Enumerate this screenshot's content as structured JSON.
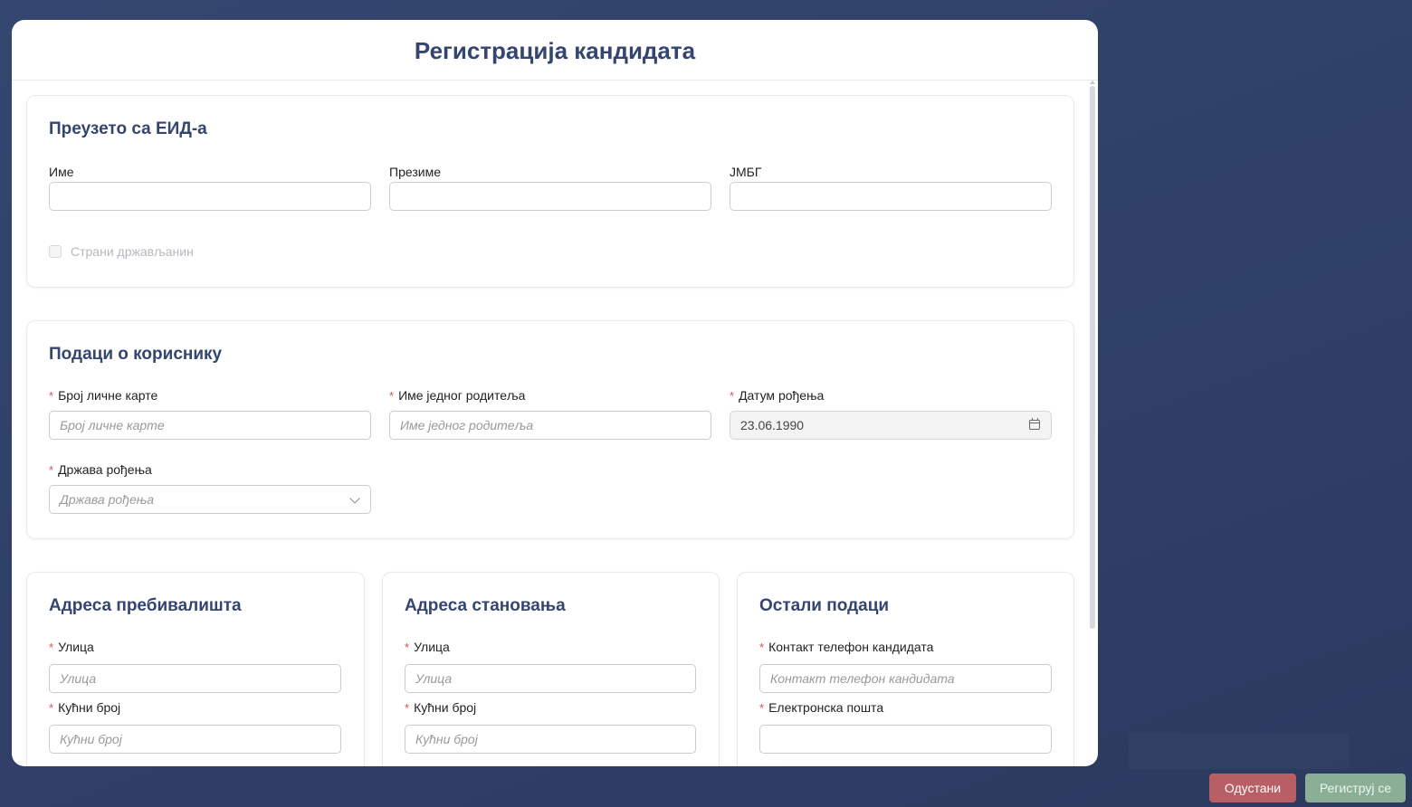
{
  "modal": {
    "title": "Регистрација кандидата"
  },
  "eid_section": {
    "title": "Преузето са ЕИД-а",
    "fields": [
      {
        "label": "Име",
        "value": ""
      },
      {
        "label": "Презиме",
        "value": ""
      },
      {
        "label": "ЈМБГ",
        "value": ""
      }
    ],
    "foreign_citizen": {
      "label": "Страни држављанин",
      "checked": false
    }
  },
  "user_section": {
    "title": "Подаци о кориснику",
    "id_card": {
      "label": "Број личне карте",
      "placeholder": "Број личне карте",
      "required": true
    },
    "parent_name": {
      "label": "Име једног родитеља",
      "placeholder": "Име једног родитеља",
      "required": true
    },
    "birth_date": {
      "label": "Датум рођења",
      "value": "23.06.1990",
      "required": true,
      "icon": "calendar-icon"
    },
    "birth_country": {
      "label": "Држава рођења",
      "placeholder": "Држава рођења",
      "required": true,
      "icon": "chevron-down-icon"
    }
  },
  "residence_section": {
    "title": "Адреса пребивалишта",
    "street": {
      "label": "Улица",
      "placeholder": "Улица"
    },
    "house_number": {
      "label": "Кућни број",
      "placeholder": "Кућни број"
    }
  },
  "living_section": {
    "title": "Адреса становања",
    "street": {
      "label": "Улица",
      "placeholder": "Улица"
    },
    "house_number": {
      "label": "Кућни број",
      "placeholder": "Кућни број"
    }
  },
  "other_section": {
    "title": "Остали подаци",
    "phone": {
      "label": "Контакт телефон кандидата",
      "placeholder": "Контакт телефон кандидата"
    },
    "email": {
      "label": "Електронска пошта",
      "value": ""
    }
  },
  "footer": {
    "cancel_label": "Одустани",
    "register_label": "Региструј се"
  },
  "colors": {
    "accent": "#34466f",
    "required": "#d9534f",
    "cancel_button": "#b85f65",
    "register_button": "#8aaf96"
  }
}
